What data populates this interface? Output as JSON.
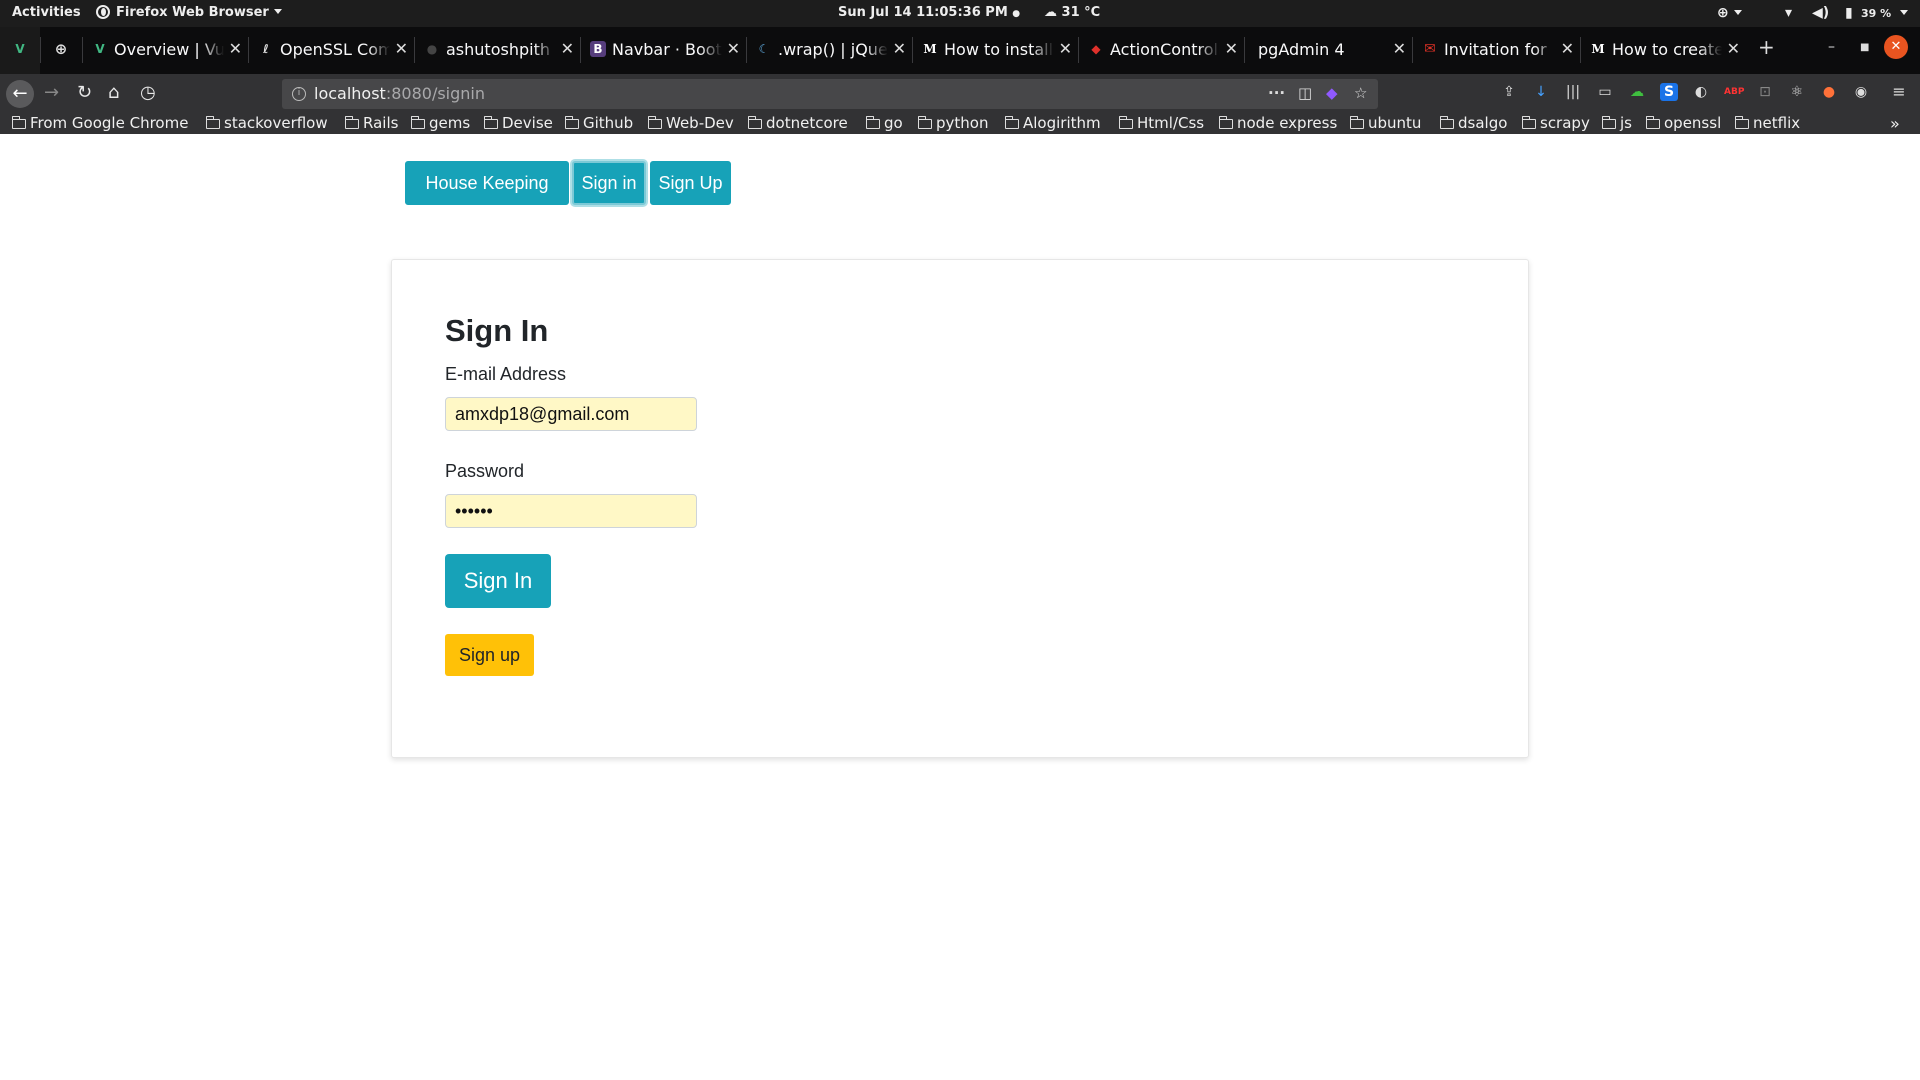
{
  "system_bar": {
    "activities": "Activities",
    "app_menu": "Firefox Web Browser",
    "clock": "Sun Jul 14  11:05:36 PM",
    "weather": "31 °C",
    "battery": "39 %"
  },
  "tabs": [
    {
      "title": "",
      "favicon": "vue-logo-icon"
    },
    {
      "title": "",
      "favicon": "globe-icon"
    },
    {
      "title": "Overview | Vue",
      "favicon": "vue-logo-icon"
    },
    {
      "title": "OpenSSL Commands",
      "favicon": "openssl-icon"
    },
    {
      "title": "ashutoshpith",
      "favicon": "github-icon"
    },
    {
      "title": "Navbar · Bootstrap",
      "favicon": "bootstrap-icon"
    },
    {
      "title": ".wrap() | jQuery",
      "favicon": "jquery-icon"
    },
    {
      "title": "How to install",
      "favicon": "medium-icon"
    },
    {
      "title": "ActionController",
      "favicon": "rails-icon"
    },
    {
      "title": "pgAdmin 4",
      "favicon": ""
    },
    {
      "title": "Invitation for",
      "favicon": "gmail-icon"
    },
    {
      "title": "How to create",
      "favicon": "medium-icon"
    }
  ],
  "url": {
    "host": "localhost",
    "rest": ":8080/signin"
  },
  "bookmarks": [
    "From Google Chrome",
    "stackoverflow",
    "Rails",
    "gems",
    "Devise",
    "Github",
    "Web-Dev",
    "dotnetcore",
    "go",
    "python",
    "Alogirithm",
    "Html/Css",
    "node express",
    "ubuntu",
    "dsalgo",
    "scrapy",
    "js",
    "openssl",
    "netflix"
  ],
  "page": {
    "nav": {
      "brand": "House Keeping",
      "signin": "Sign in",
      "signup": "Sign Up"
    },
    "form": {
      "title": "Sign In",
      "email_label": "E-mail Address",
      "email_value": "amxdp18@gmail.com",
      "password_label": "Password",
      "password_value": "••••••",
      "submit_label": "Sign In",
      "signup_label": "Sign up"
    }
  },
  "colors": {
    "primary": "#17a2b8",
    "warning": "#ffc107",
    "autofill": "#fff8c6"
  }
}
